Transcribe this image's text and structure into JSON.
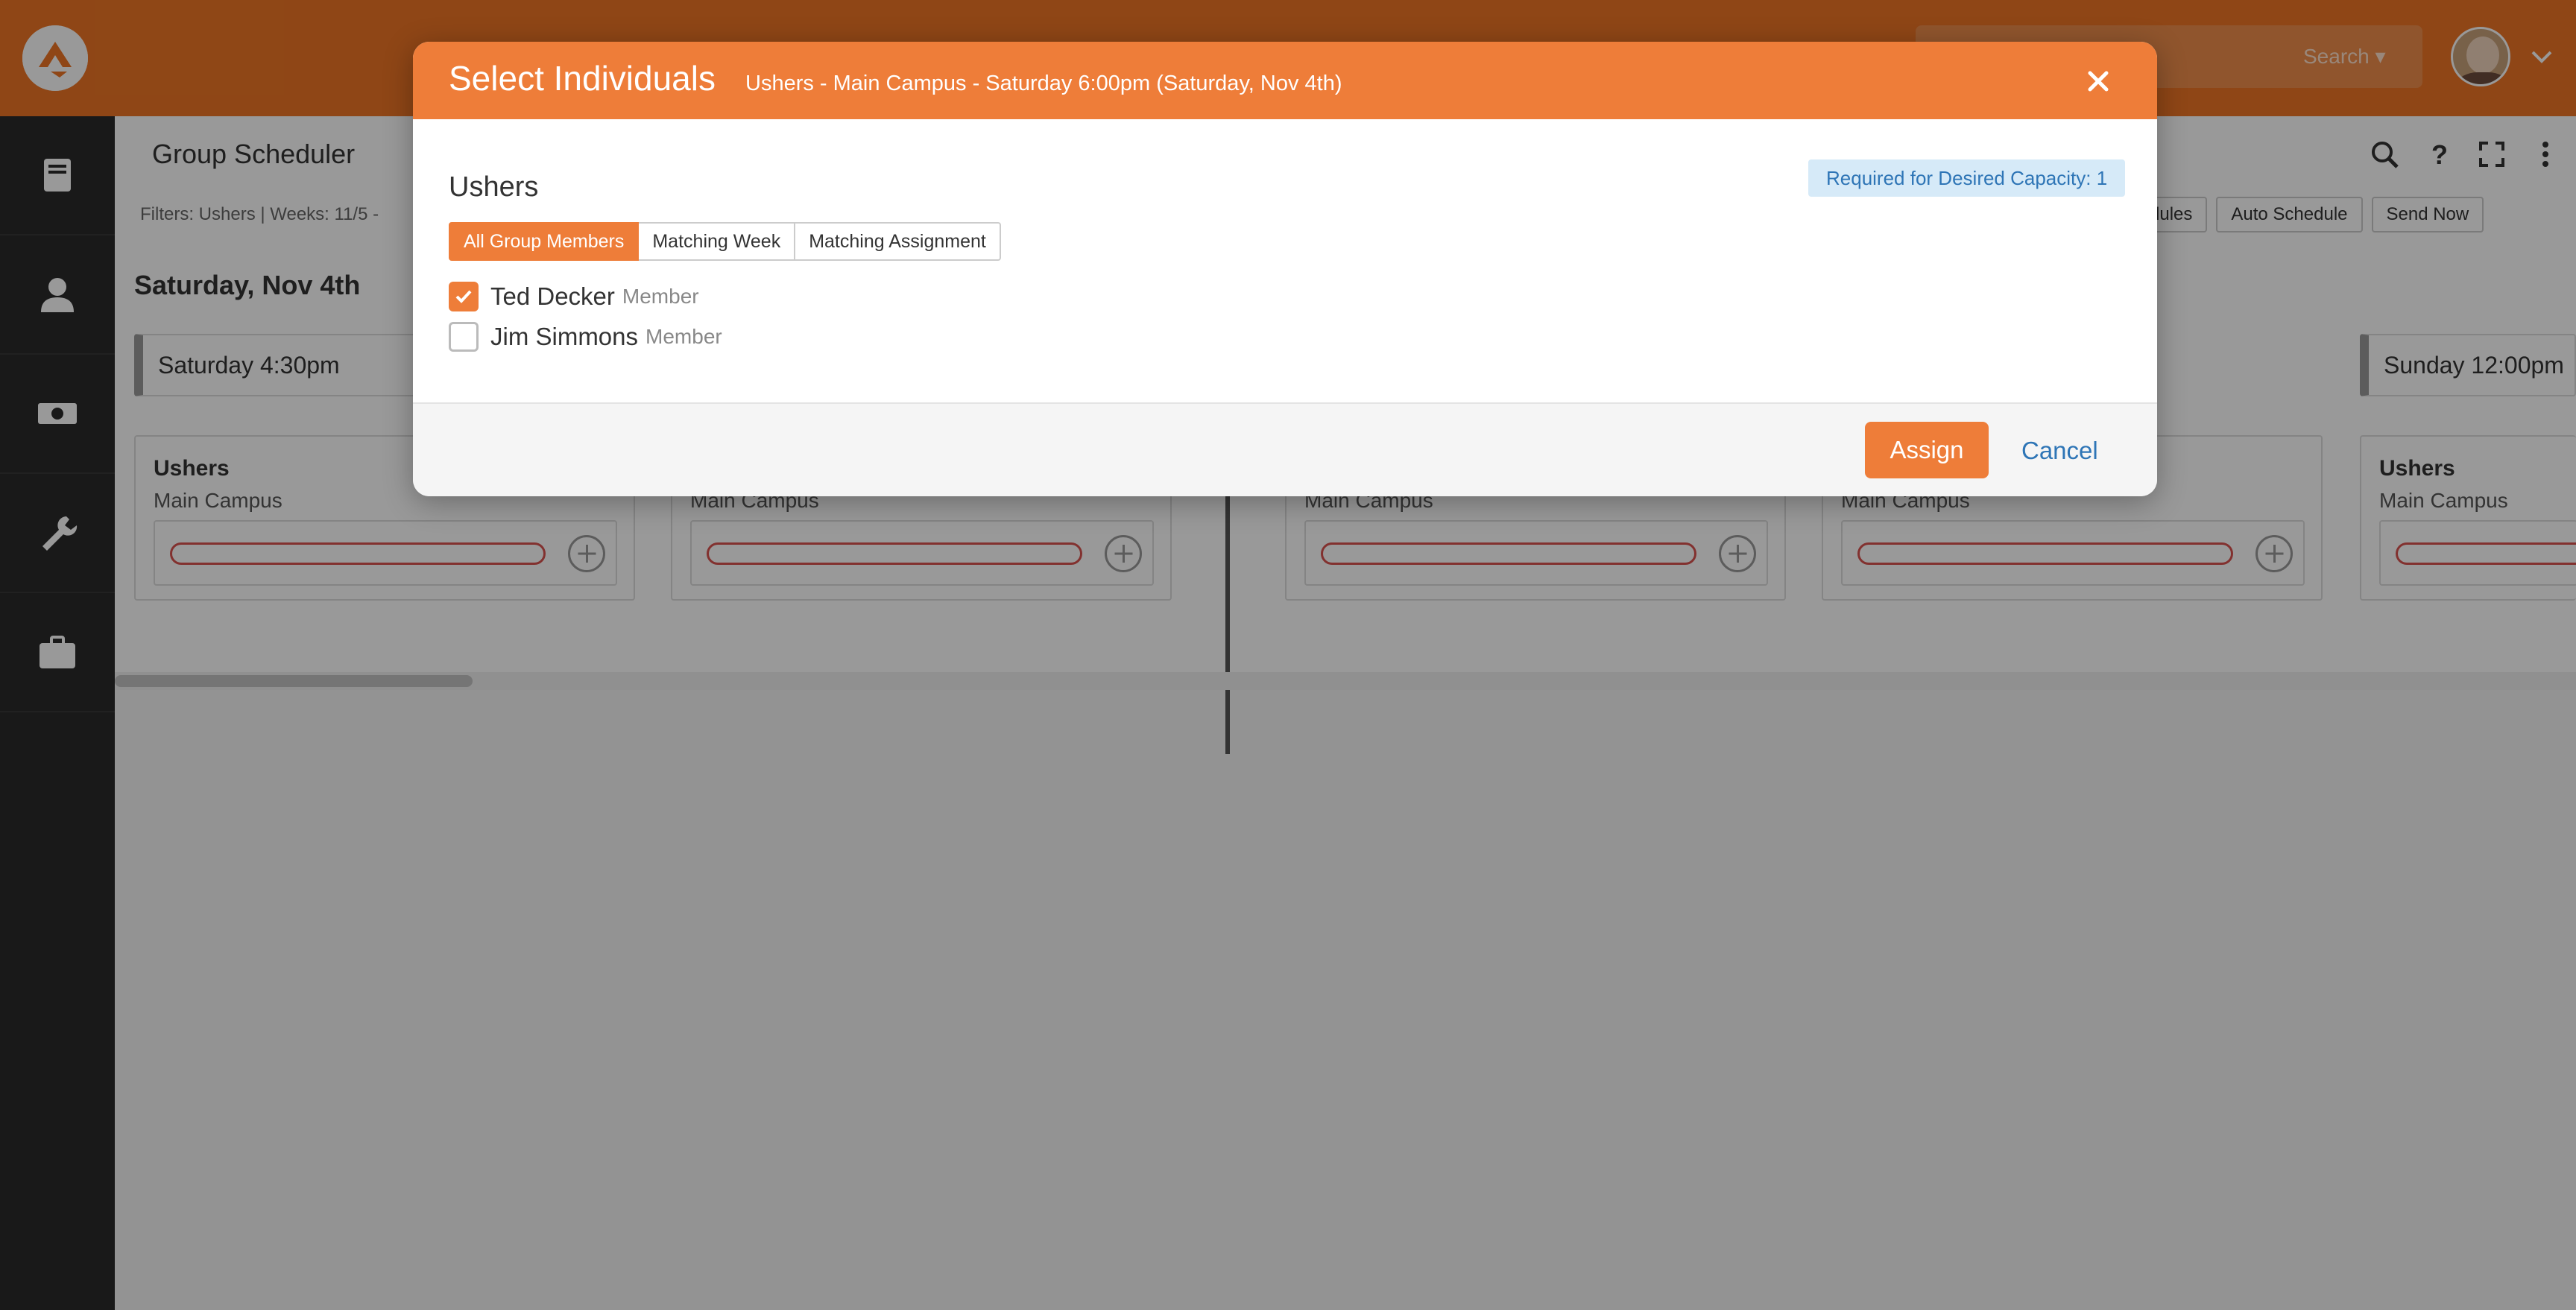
{
  "app": {
    "search_label": "Search ▾"
  },
  "page": {
    "title": "Group Scheduler",
    "filters_text": "Filters: Ushers | Weeks: 11/5 -",
    "toolbar": {
      "update_schedules": "dules",
      "auto_schedule": "Auto Schedule",
      "send_now": "Send Now"
    },
    "day_heading": "Saturday, Nov 4th",
    "occurrences": [
      {
        "time": "Saturday 4:30pm",
        "group": "Ushers",
        "location": "Main Campus"
      },
      {
        "time": "",
        "group": "",
        "location": "Main Campus"
      },
      {
        "time": "",
        "group": "",
        "location": "Main Campus"
      },
      {
        "time": "",
        "group": "",
        "location": "Main Campus"
      },
      {
        "time": "Sunday 12:00pm",
        "group": "Ushers",
        "location": "Main Campus"
      }
    ]
  },
  "modal": {
    "title": "Select Individuals",
    "subtitle": "Ushers - Main Campus - Saturday 6:00pm (Saturday, Nov 4th)",
    "group_name": "Ushers",
    "capacity_badge": "Required for Desired Capacity: 1",
    "filter_buttons": [
      {
        "label": "All Group Members",
        "active": true
      },
      {
        "label": "Matching Week",
        "active": false
      },
      {
        "label": "Matching Assignment",
        "active": false
      }
    ],
    "members": [
      {
        "name": "Ted Decker",
        "role": "Member",
        "checked": true
      },
      {
        "name": "Jim Simmons",
        "role": "Member",
        "checked": false
      }
    ],
    "assign_label": "Assign",
    "cancel_label": "Cancel"
  },
  "colors": {
    "brand_orange": "#ee7d39",
    "link_blue": "#2e75b6",
    "badge_bg": "#d6eaf8",
    "danger_red": "#d9534f"
  }
}
